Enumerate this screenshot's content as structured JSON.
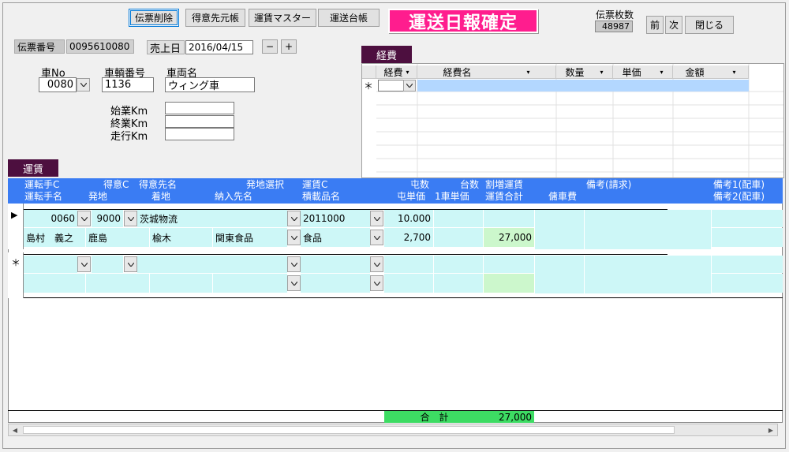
{
  "toolbar": {
    "delete_slip": "伝票削除",
    "customer_ledger": "得意先元帳",
    "fare_master": "運賃マスター",
    "transport_ledger": "運送台帳",
    "confirm_banner": "運送日報確定"
  },
  "slip_count": {
    "label": "伝票枚数",
    "value": "48987"
  },
  "nav": {
    "prev": "前",
    "next": "次",
    "close": "閉じる"
  },
  "header": {
    "slip_no_label": "伝票番号",
    "slip_no": "0095610080",
    "sale_date_label": "売上日",
    "sale_date": "2016/04/15",
    "minus": "−",
    "plus": "+"
  },
  "vehicle": {
    "car_no_label": "車No",
    "car_no": "0080",
    "plate_label": "車輌番号",
    "plate": "1136",
    "car_name_label": "車両名",
    "car_name": "ウィング車",
    "start_km_label": "始業Km",
    "end_km_label": "終業Km",
    "run_km_label": "走行Km",
    "start_km": "",
    "end_km": "",
    "run_km": ""
  },
  "expense": {
    "tab": "経費",
    "columns": [
      "経費",
      "経費名",
      "数量",
      "単価",
      "金額"
    ],
    "new_row_marker": "＊"
  },
  "fare": {
    "tab": "運賃",
    "header_row1": {
      "driver_c": "運転手C",
      "customer_c": "得意C",
      "customer_name": "得意先名",
      "origin_select": "発地選択",
      "fare_c": "運賃C",
      "tonnage": "屯数",
      "units": "台数",
      "surcharge": "割増運賃",
      "remark_bill": "備考(請求)",
      "remark1": "備考1(配車)"
    },
    "header_row2": {
      "driver_name": "運転手名",
      "origin": "発地",
      "destination": "着地",
      "delivery_name": "納入先名",
      "cargo_name": "積載品名",
      "ton_price": "屯単価",
      "unit_price": "1車単価",
      "fare_total": "運賃合計",
      "charter_fee": "傭車費",
      "remark2": "備考2(配車)"
    },
    "row1": {
      "driver_c": "0060",
      "customer_c": "9000",
      "customer_name": "茨城物流",
      "fare_c": "2011000",
      "tonnage": "10.000",
      "driver_name": "島村　義之",
      "origin": "鹿島",
      "destination": "楡木",
      "delivery_name": "関東食品",
      "cargo_name": "食品",
      "ton_price": "2,700",
      "fare_total": "27,000"
    },
    "record_marker": "▶",
    "new_row_marker": "＊",
    "total_label": "合　計",
    "total_value": "27,000"
  }
}
